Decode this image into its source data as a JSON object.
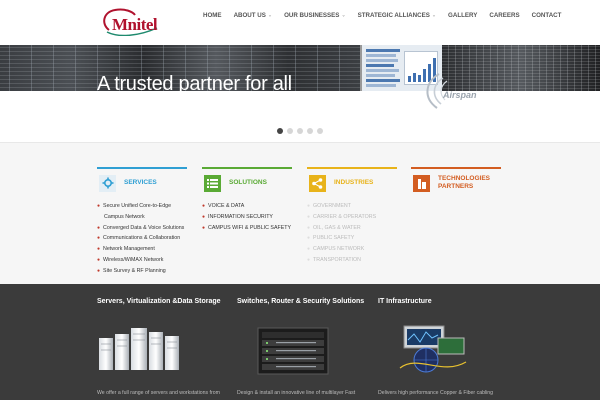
{
  "brand": {
    "logo_text": "Mnitel",
    "accent": "#b0122e"
  },
  "nav": {
    "items": [
      {
        "label": "HOME",
        "has_caret": false
      },
      {
        "label": "ABOUT US",
        "has_caret": true
      },
      {
        "label": "OUR BUSINESSES",
        "has_caret": true
      },
      {
        "label": "STRATEGIC ALLIANCES",
        "has_caret": true
      },
      {
        "label": "GALLERY",
        "has_caret": false
      },
      {
        "label": "CAREERS",
        "has_caret": false
      },
      {
        "label": "CONTACT",
        "has_caret": false
      }
    ],
    "caret_glyph": "⌄"
  },
  "hero": {
    "title": "A trusted partner for all"
  },
  "slider": {
    "count": 5,
    "active_index": 0
  },
  "features": {
    "services": {
      "title": "SERVICES",
      "color": "#2f9fd3",
      "icon": "gear-icon",
      "items": [
        "Secure Unified Core-to-Edge",
        "Campus Network",
        "Converged Data & Voice Solutions",
        "Communications & Collaboration",
        "Network Management",
        "Wireless/WiMAX Network",
        "Site Survey & RF Planning"
      ]
    },
    "solutions": {
      "title": "SOLUTIONS",
      "color": "#5aaa35",
      "icon": "list-icon",
      "items": [
        "VOICE & DATA",
        "INFORMATION SECURITY",
        "CAMPUS WIFI & PUBLIC SAFETY"
      ]
    },
    "industries": {
      "title": "INDUSTRIES",
      "color": "#e8b31a",
      "icon": "share-icon",
      "items": [
        "GOVERNMENT",
        "CARRIER & OPERATORS",
        "OIL, GAS & WATER",
        "PUBLIC SAFETY",
        "CAMPUS NETWORK",
        "TRANSPORTATION"
      ]
    },
    "partners": {
      "title_line1": "TECHNOLOGIES",
      "title_line2": "PARTNERS",
      "color": "#d35d21",
      "icon": "building-icon",
      "partner_logo": "Airspan"
    }
  },
  "products": {
    "servers": {
      "title": "Servers, Virtualization &Data Storage",
      "text": "We offer a full range of servers and workstations from"
    },
    "switches": {
      "title": "Switches, Router & Security Solutions",
      "text": "Design & install an innovative line of multilayer Fast"
    },
    "infra": {
      "title": "IT Infrastructure",
      "text": "Delivers high performance Copper & Fiber cabling"
    }
  }
}
